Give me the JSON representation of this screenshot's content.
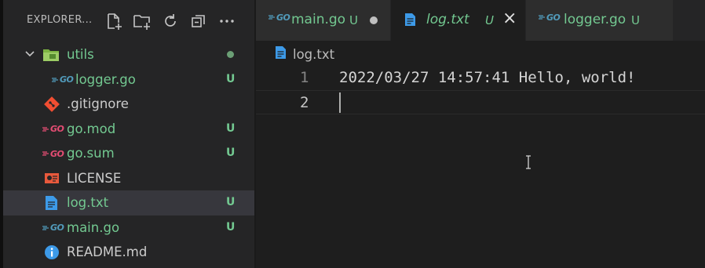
{
  "explorer": {
    "title": "EXPLORER...",
    "actions": [
      "new-file-icon",
      "new-folder-icon",
      "refresh-icon",
      "collapse-all-icon",
      "more-icon"
    ]
  },
  "tree": [
    {
      "name": "utils",
      "type": "folder",
      "status": "dot"
    },
    {
      "name": "logger.go",
      "type": "go",
      "status": "U"
    },
    {
      "name": ".gitignore",
      "type": "git",
      "status": ""
    },
    {
      "name": "go.mod",
      "type": "gomod",
      "status": "U"
    },
    {
      "name": "go.sum",
      "type": "gomod",
      "status": "U"
    },
    {
      "name": "LICENSE",
      "type": "license",
      "status": ""
    },
    {
      "name": "log.txt",
      "type": "txt",
      "status": "U"
    },
    {
      "name": "main.go",
      "type": "go",
      "status": "U"
    },
    {
      "name": "README.md",
      "type": "info",
      "status": ""
    }
  ],
  "go_glyph": "GO",
  "tabs": [
    {
      "label": "main.go",
      "badge": "U",
      "state": "modified"
    },
    {
      "label": "log.txt",
      "badge": "U",
      "state": "active"
    },
    {
      "label": "logger.go",
      "badge": "U",
      "state": "normal"
    }
  ],
  "close_glyph": "×",
  "breadcrumb": {
    "file": "log.txt"
  },
  "editor": {
    "lines": [
      {
        "number": "1",
        "text": "2022/03/27 14:57:41 Hello, world!"
      },
      {
        "number": "2",
        "text": ""
      }
    ],
    "current_line": 2
  },
  "colors": {
    "untracked": "#73c991",
    "go": "#519aba",
    "gomod": "#e44d73",
    "git": "#f14e32",
    "license": "#e8593c",
    "txt": "#3d9ae8",
    "folder": "#8bc34a"
  }
}
